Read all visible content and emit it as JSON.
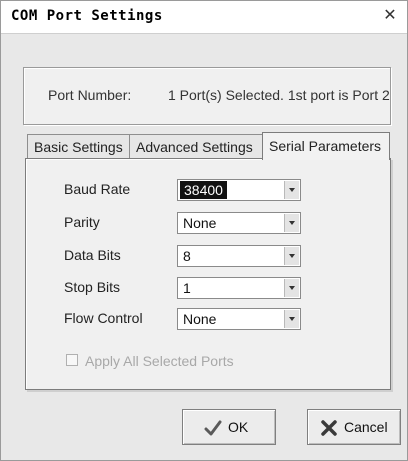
{
  "window": {
    "title": "COM Port Settings",
    "close_glyph": "✕"
  },
  "port": {
    "label": "Port Number:",
    "value": "1 Port(s) Selected. 1st port is Port 2"
  },
  "tabs": [
    {
      "label": "Basic Settings",
      "active": false
    },
    {
      "label": "Advanced Settings",
      "active": false
    },
    {
      "label": "Serial Parameters",
      "active": true
    }
  ],
  "fields": [
    {
      "label": "Baud Rate",
      "value": "38400",
      "selected": true
    },
    {
      "label": "Parity",
      "value": "None"
    },
    {
      "label": "Data Bits",
      "value": "8"
    },
    {
      "label": "Stop Bits",
      "value": "1"
    },
    {
      "label": "Flow Control",
      "value": "None"
    }
  ],
  "apply_all": {
    "label": "Apply All Selected Ports",
    "checked": false,
    "enabled": false
  },
  "buttons": {
    "ok": {
      "label": "OK",
      "icon": "checkmark-icon"
    },
    "cancel": {
      "label": "Cancel",
      "icon": "x-icon"
    }
  }
}
